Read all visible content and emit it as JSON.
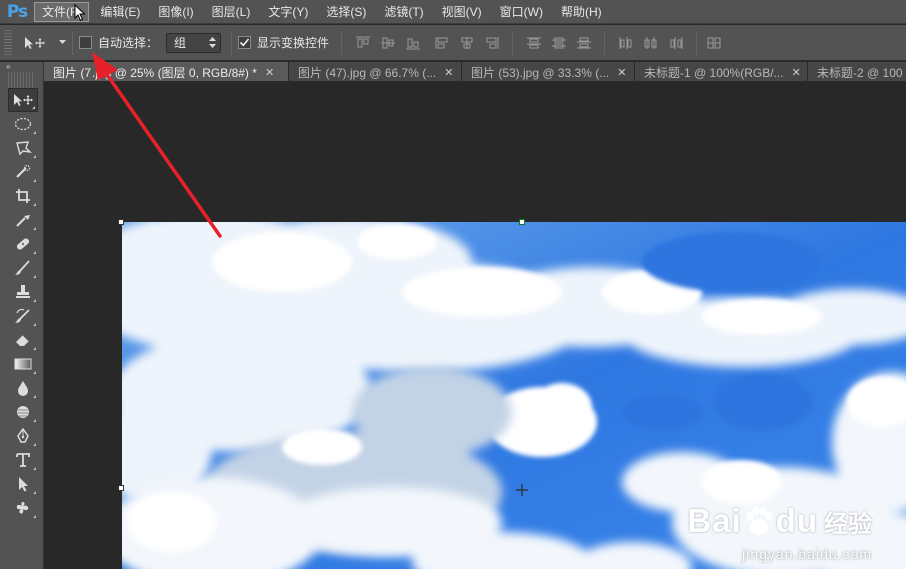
{
  "app": {
    "logo": "Ps"
  },
  "menu": {
    "items": [
      {
        "label": "文件(F)"
      },
      {
        "label": "编辑(E)"
      },
      {
        "label": "图像(I)"
      },
      {
        "label": "图层(L)"
      },
      {
        "label": "文字(Y)"
      },
      {
        "label": "选择(S)"
      },
      {
        "label": "滤镜(T)"
      },
      {
        "label": "视图(V)"
      },
      {
        "label": "窗口(W)"
      },
      {
        "label": "帮助(H)"
      }
    ]
  },
  "options": {
    "auto_select_label": "自动选择：",
    "auto_select_checked": false,
    "auto_select_value": "组",
    "show_transform_label": "显示变换控件",
    "show_transform_checked": true
  },
  "toolbar": {
    "header": "»",
    "tools": [
      "move-tool-icon",
      "ellipse-marquee-icon",
      "lasso-icon",
      "quick-select-icon",
      "crop-icon",
      "eyedropper-icon",
      "healing-brush-icon",
      "brush-icon",
      "clone-stamp-icon",
      "history-brush-icon",
      "eraser-icon",
      "gradient-icon",
      "blur-icon",
      "dodge-icon",
      "pen-icon",
      "type-icon",
      "path-select-icon",
      "custom-shape-icon"
    ]
  },
  "tabs": [
    {
      "label": "图片 (7",
      "label_hidden_suffix": ".jpg @ 25% (图层 0, RGB/8#) *",
      "active": true
    },
    {
      "label": "图片 (47).jpg @ 66.7% (...",
      "active": false
    },
    {
      "label": "图片 (53).jpg @ 33.3% (...",
      "active": false
    },
    {
      "label": "未标题-1 @ 100%(RGB/...",
      "active": false
    },
    {
      "label": "未标题-2 @ 100",
      "active": false
    }
  ],
  "watermark": {
    "brand": "Bai",
    "brand2": "du",
    "cn": "经验",
    "url": "jingyan.baidu.com"
  },
  "colors": {
    "panel": "#535353",
    "canvas": "#282828",
    "annotation_arrow": "#e8202a",
    "sky": "#3d7ee6"
  }
}
